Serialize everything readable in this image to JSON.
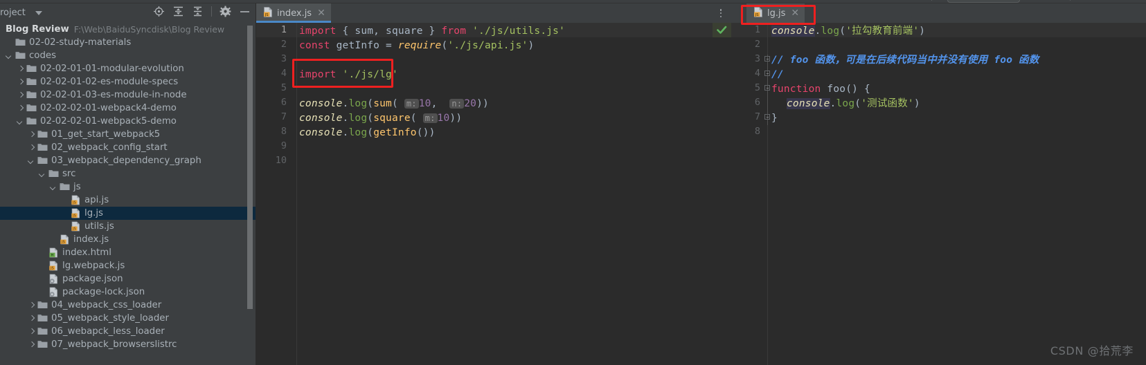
{
  "sidebar": {
    "panel_title": "roject",
    "caret_icon": "chevron-down-icon",
    "tools": [
      {
        "name": "locate-icon",
        "title": "Select Opened File"
      },
      {
        "name": "expand-all-icon",
        "title": "Expand All"
      },
      {
        "name": "collapse-all-icon",
        "title": "Collapse All"
      },
      {
        "name": "gear-icon",
        "title": "Settings"
      },
      {
        "name": "minimize-icon",
        "title": "Hide"
      }
    ],
    "project_name": "Blog Review",
    "project_path": "F:\\Web\\BaiduSyncdisk\\Blog Review",
    "tree": [
      {
        "label": "02-02-study-materials",
        "indent": 0,
        "twisty": "none",
        "icon": "folder",
        "selected": false
      },
      {
        "label": "codes",
        "indent": 0,
        "twisty": "down",
        "icon": "folder",
        "selected": false
      },
      {
        "label": "02-02-01-01-modular-evolution",
        "indent": 1,
        "twisty": "right",
        "icon": "folder",
        "selected": false
      },
      {
        "label": "02-02-01-02-es-module-specs",
        "indent": 1,
        "twisty": "right",
        "icon": "folder",
        "selected": false
      },
      {
        "label": "02-02-01-03-es-module-in-node",
        "indent": 1,
        "twisty": "right",
        "icon": "folder",
        "selected": false
      },
      {
        "label": "02-02-02-01-webpack4-demo",
        "indent": 1,
        "twisty": "right",
        "icon": "folder",
        "selected": false
      },
      {
        "label": "02-02-02-01-webpack5-demo",
        "indent": 1,
        "twisty": "down",
        "icon": "folder",
        "selected": false
      },
      {
        "label": "01_get_start_webpack5",
        "indent": 2,
        "twisty": "right",
        "icon": "folder",
        "selected": false
      },
      {
        "label": "02_webpack_config_start",
        "indent": 2,
        "twisty": "right",
        "icon": "folder",
        "selected": false
      },
      {
        "label": "03_webpack_dependency_graph",
        "indent": 2,
        "twisty": "down",
        "icon": "folder",
        "selected": false
      },
      {
        "label": "src",
        "indent": 3,
        "twisty": "down",
        "icon": "folder",
        "selected": false
      },
      {
        "label": "js",
        "indent": 4,
        "twisty": "down",
        "icon": "folder",
        "selected": false
      },
      {
        "label": "api.js",
        "indent": 5,
        "twisty": "none",
        "icon": "js",
        "selected": false
      },
      {
        "label": "lg.js",
        "indent": 5,
        "twisty": "none",
        "icon": "js",
        "selected": true
      },
      {
        "label": "utils.js",
        "indent": 5,
        "twisty": "none",
        "icon": "js",
        "selected": false
      },
      {
        "label": "index.js",
        "indent": 4,
        "twisty": "none",
        "icon": "js",
        "selected": false
      },
      {
        "label": "index.html",
        "indent": 3,
        "twisty": "none",
        "icon": "html",
        "selected": false
      },
      {
        "label": "lg.webpack.js",
        "indent": 3,
        "twisty": "none",
        "icon": "js",
        "selected": false
      },
      {
        "label": "package.json",
        "indent": 3,
        "twisty": "none",
        "icon": "json",
        "selected": false
      },
      {
        "label": "package-lock.json",
        "indent": 3,
        "twisty": "none",
        "icon": "json",
        "selected": false
      },
      {
        "label": "04_webpack_css_loader",
        "indent": 2,
        "twisty": "right",
        "icon": "folder",
        "selected": false
      },
      {
        "label": "05_webpack_style_loader",
        "indent": 2,
        "twisty": "right",
        "icon": "folder",
        "selected": false
      },
      {
        "label": "06_webapck_less_loader",
        "indent": 2,
        "twisty": "right",
        "icon": "folder",
        "selected": false
      },
      {
        "label": "07_webpack_browserslistrc",
        "indent": 2,
        "twisty": "right",
        "icon": "folder",
        "selected": false
      }
    ]
  },
  "main_editor": {
    "tab": {
      "label": "index.js",
      "icon": "js-file-icon",
      "close_icon": "close-icon"
    },
    "kebab_icon": "more-options-icon",
    "status_icon": "inspection-ok-icon",
    "line_numbers": [
      "1",
      "2",
      "3",
      "4",
      "5",
      "6",
      "7",
      "8",
      "9",
      "10"
    ],
    "code": {
      "l1": {
        "kw": "import",
        "braces": "{ sum, square }",
        "from": "from",
        "path": "'./js/utils.js'"
      },
      "l2": {
        "kw": "const",
        "name": "getInfo",
        "eq": "=",
        "fn": "require",
        "arg": "'./js/api.js'"
      },
      "l4": {
        "kw": "import",
        "path": "'./js/lg'"
      },
      "l6": {
        "obj": "console",
        "method": "log",
        "fn": "sum",
        "hint1": "m:",
        "val1": "10",
        "hint2": "n:",
        "val2": "20"
      },
      "l7": {
        "obj": "console",
        "method": "log",
        "fn": "square",
        "hint1": "m:",
        "val1": "10"
      },
      "l8": {
        "obj": "console",
        "method": "log",
        "fn": "getInfo"
      }
    },
    "highlight_box_label": "import-lg-highlight"
  },
  "right_editor": {
    "tab": {
      "label": "lg.js",
      "icon": "js-file-icon",
      "close_icon": "close-icon"
    },
    "status_icon": "inspection-ok-icon",
    "line_numbers": [
      "1",
      "2",
      "3",
      "4",
      "5",
      "6",
      "7",
      "8"
    ],
    "code": {
      "l1": {
        "obj": "console",
        "method": "log",
        "str": "'拉勾教育前端'"
      },
      "l3": {
        "comment": "// foo 函数，可是在后续代码当中并没有使用 foo 函数"
      },
      "l4": {
        "comment": "//"
      },
      "l5": {
        "kw": "function",
        "name": "foo",
        "tail": "() {"
      },
      "l6": {
        "obj": "console",
        "method": "log",
        "str": "'测试函数'"
      },
      "l7": {
        "brace": "}"
      }
    },
    "highlight_box_label": "lg-tab-highlight"
  },
  "watermark": "CSDN @拾荒李",
  "colors": {
    "accent_blue": "#4a88c7",
    "selection_blue": "#0d293e",
    "highlight_red": "#ee2020",
    "editor_bg": "#2b2b2b",
    "panel_bg": "#3c3f41",
    "string_green": "#a5c261",
    "keyword_orange": "#cc7832",
    "keyword_pink": "#e8446c",
    "comment_blue": "#5394ec",
    "number_purple": "#9876aa",
    "function_yellow": "#ffc66d"
  }
}
